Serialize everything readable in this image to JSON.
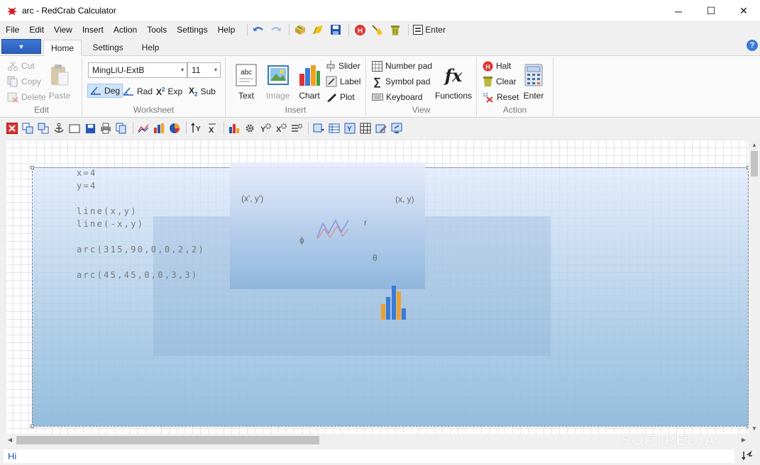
{
  "window": {
    "title": "arc - RedCrab Calculator"
  },
  "menu": {
    "items": [
      "File",
      "Edit",
      "View",
      "Insert",
      "Action",
      "Tools",
      "Settings",
      "Help"
    ],
    "enter_label": "Enter"
  },
  "ribbon_tabs": [
    "Home",
    "Settings",
    "Help"
  ],
  "ribbon": {
    "edit": {
      "cut": "Cut",
      "copy": "Copy",
      "delete": "Delete",
      "paste": "Paste",
      "label": "Edit"
    },
    "worksheet": {
      "font": "MingLiU-ExtB",
      "size": "11",
      "deg": "Deg",
      "rad": "Rad",
      "exp": "Exp",
      "sub": "Sub",
      "label": "Worksheet"
    },
    "insert": {
      "text": "Text",
      "image": "Image",
      "chart": "Chart",
      "slider": "Slider",
      "label_btn": "Label",
      "plot": "Plot",
      "label": "Insert"
    },
    "view": {
      "number_pad": "Number pad",
      "symbol_pad": "Symbol pad",
      "keyboard": "Keyboard",
      "functions": "Functions",
      "label": "View"
    },
    "action": {
      "halt": "Halt",
      "clear": "Clear",
      "reset": "Reset",
      "enter": "Enter",
      "label": "Action"
    }
  },
  "worksheet_content": {
    "code": [
      "x=4",
      "y=4",
      "line(x,y)",
      "line(-x,y)",
      "arc(315,90,0,0,2,2)",
      "arc(45,45,0,0,3,3)"
    ],
    "overlay_labels": {
      "prime_point": "(x', y')",
      "point": "(x, y)",
      "r": "r",
      "phi": "ϕ",
      "theta": "θ"
    }
  },
  "status": {
    "text": "Hi"
  },
  "watermark": "SOFTPEDIA",
  "colors": {
    "accent": "#2a5db8",
    "sheet_gradient_bottom": "#8cb9da",
    "grid": "#e3e3ee"
  }
}
